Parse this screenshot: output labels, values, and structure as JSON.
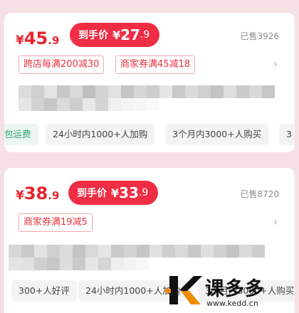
{
  "products": [
    {
      "price_currency": "¥",
      "price_integer": "45",
      "price_decimal": ".9",
      "final_label": "到手价",
      "final_currency": "¥",
      "final_integer": "27",
      "final_decimal": ".9",
      "sold": "已售3926",
      "coupons": [
        "跨店每满200减30",
        "商家券满45减18"
      ],
      "tags": [
        "包运费",
        "24小时内1000+人加购",
        "3个月内3000+人购买",
        "3"
      ]
    },
    {
      "price_currency": "¥",
      "price_integer": "38",
      "price_decimal": ".9",
      "final_label": "到手价",
      "final_currency": "¥",
      "final_integer": "33",
      "final_decimal": ".9",
      "sold": "已售8720",
      "coupons": [
        "商家券满19减5"
      ],
      "tags": [
        "300+人好评",
        "24小时内1000+人加购",
        "3个月内3000+人购买"
      ]
    }
  ],
  "watermark": {
    "brand": "课多多",
    "url": "www.kedd.cn"
  },
  "icons": {
    "chevron": "chevron-right-icon",
    "logo": "kedd-logo-icon"
  },
  "colors": {
    "accent": "#ef2d44",
    "price": "#e6252d",
    "background": "#f5e0e3",
    "free_shipping": "#2aa56f"
  }
}
